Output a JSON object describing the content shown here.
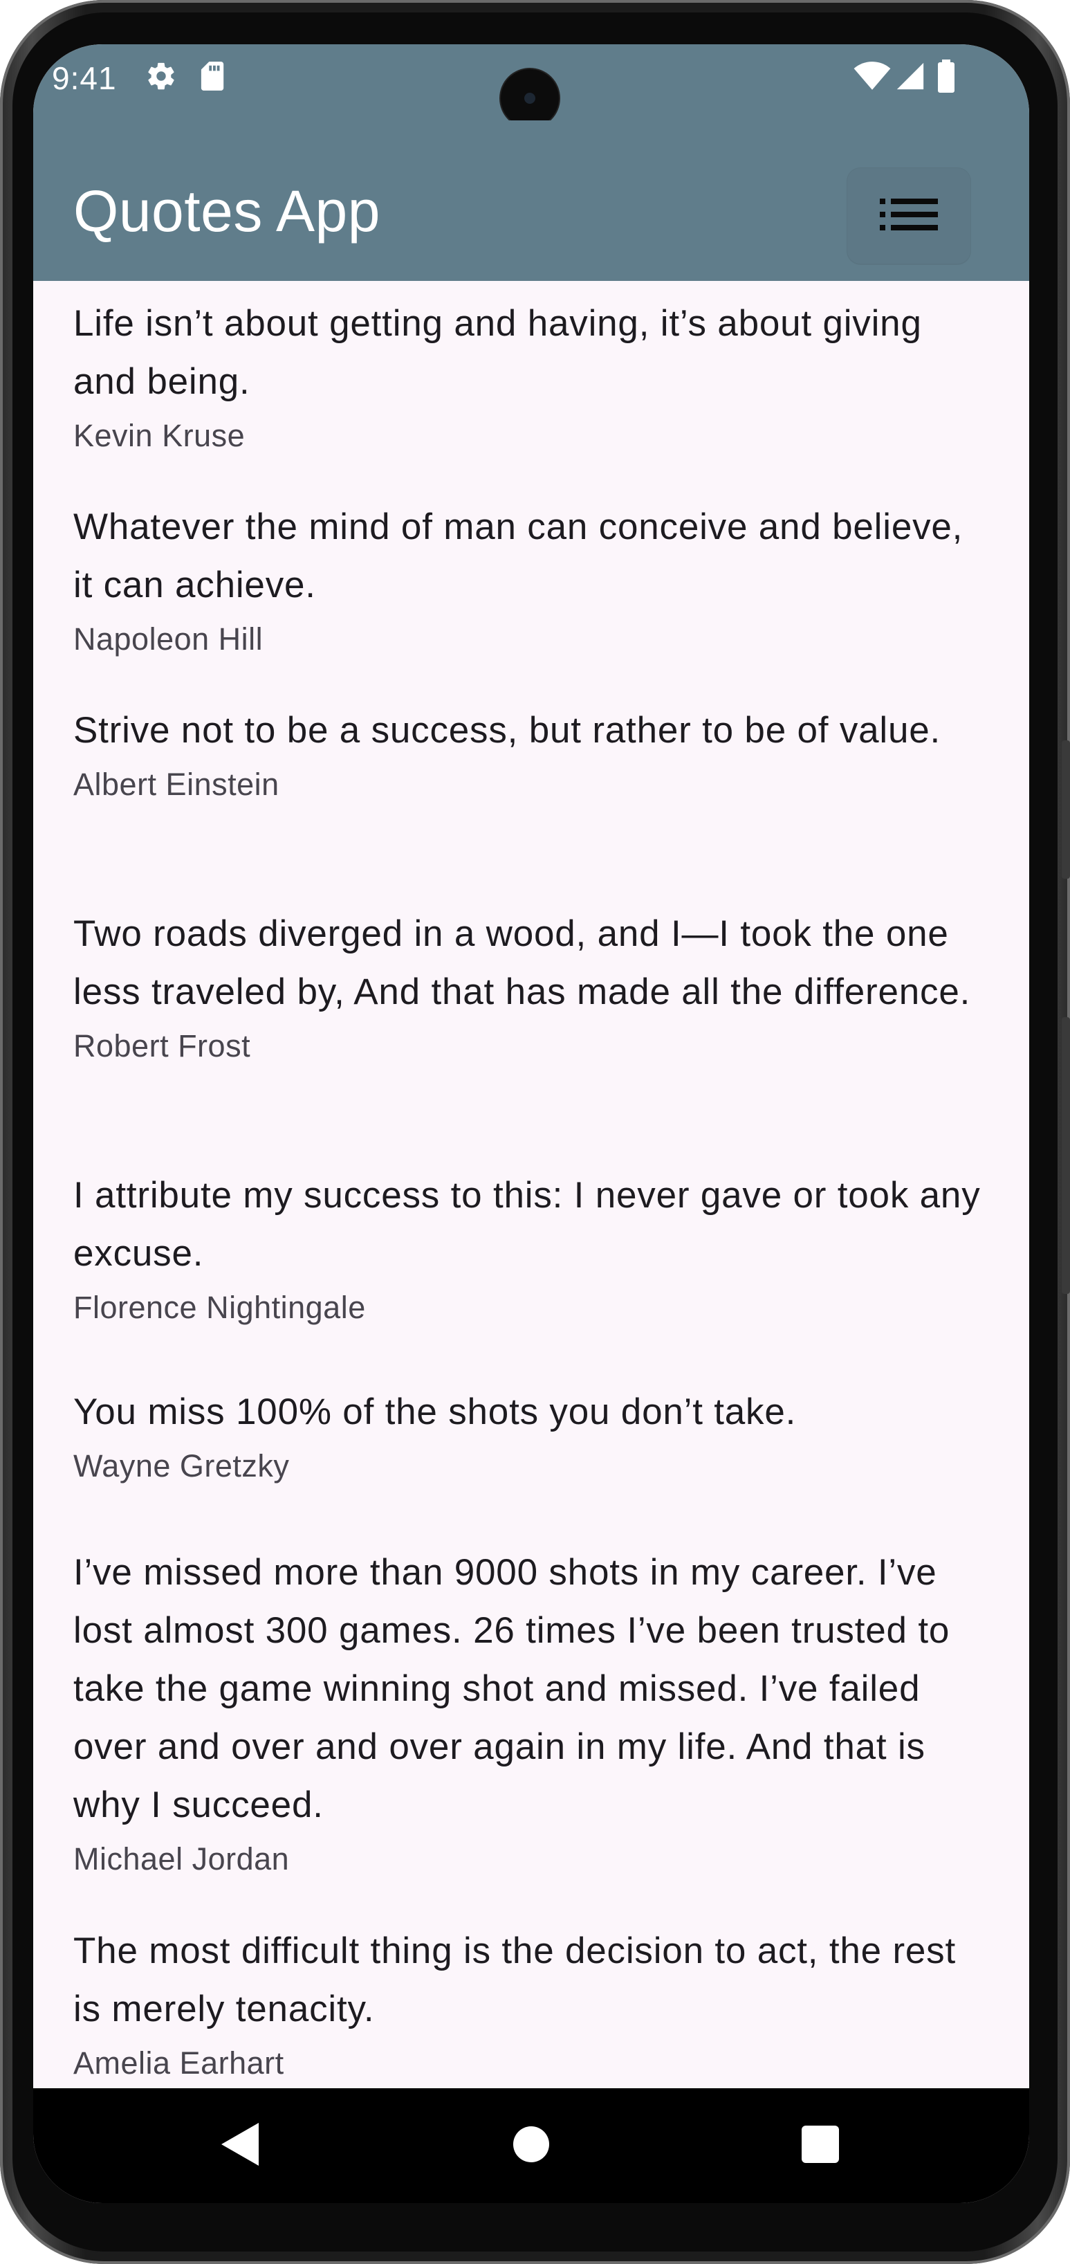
{
  "status_bar": {
    "time": "9:41",
    "icons": [
      "settings-gear-icon",
      "sd-card-icon",
      "wifi-icon",
      "cell-signal-icon",
      "battery-icon"
    ]
  },
  "app_bar": {
    "title": "Quotes App",
    "menu_icon": "list-icon",
    "color": "#607d8b"
  },
  "quotes": [
    {
      "text": "Life isn’t about getting and having, it’s about giving and being.",
      "author": "Kevin Kruse"
    },
    {
      "text": "Whatever the mind of man can conceive and believe, it can achieve.",
      "author": "Napoleon Hill"
    },
    {
      "text": "Strive not to be a success, but rather to be of value.",
      "author": "Albert Einstein"
    },
    {
      "text": "Two roads diverged in a wood, and I—I took the one less traveled by, And that has made all the difference.",
      "author": "Robert Frost"
    },
    {
      "text": "I attribute my success to this: I never gave or took any excuse.",
      "author": "Florence Nightingale"
    },
    {
      "text": "You miss 100% of the shots you don’t take.",
      "author": "Wayne Gretzky"
    },
    {
      "text": "I’ve missed more than 9000 shots in my career. I’ve lost almost 300 games. 26 times I’ve been trusted to take the game winning shot and missed. I’ve failed over and over and over again in my life. And that is why I succeed.",
      "author": "Michael Jordan"
    },
    {
      "text": "The most difficult thing is the decision to act, the rest is merely tenacity.",
      "author": "Amelia Earhart"
    }
  ],
  "nav_bar": {
    "icons": [
      "back-triangle-icon",
      "home-circle-icon",
      "recents-square-icon"
    ]
  },
  "colors": {
    "background": "#fcf6fb",
    "text": "#1d1b20",
    "author": "#48454e",
    "nav": "#000000"
  }
}
